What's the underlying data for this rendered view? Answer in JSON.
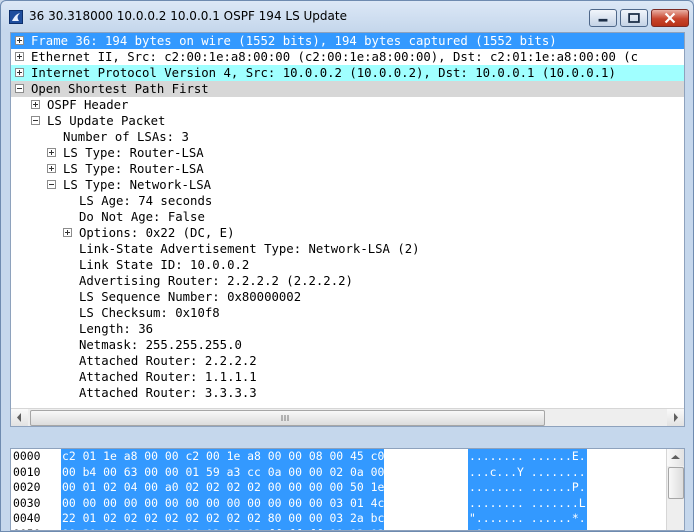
{
  "window": {
    "title": "36 30.318000 10.0.0.2 10.0.0.1 OSPF 194 LS Update"
  },
  "colors": {
    "selection": "#3399ff",
    "ip_row": "#a0ffff",
    "ospf_row": "#d7d7d7"
  },
  "tree": [
    {
      "text": "Frame 36: 194 bytes on wire (1552 bits), 194 bytes captured (1552 bits)",
      "state": "collapsed",
      "level": 0,
      "style": "sel"
    },
    {
      "text": "Ethernet II, Src: c2:00:1e:a8:00:00 (c2:00:1e:a8:00:00), Dst: c2:01:1e:a8:00:00 (c",
      "state": "collapsed",
      "level": 0,
      "style": ""
    },
    {
      "text": "Internet Protocol Version 4, Src: 10.0.0.2 (10.0.0.2), Dst: 10.0.0.1 (10.0.0.1)",
      "state": "collapsed",
      "level": 0,
      "style": "cyan"
    },
    {
      "text": "Open Shortest Path First",
      "state": "expanded",
      "level": 0,
      "style": "gray"
    },
    {
      "text": "OSPF Header",
      "state": "collapsed",
      "level": 1,
      "style": ""
    },
    {
      "text": "LS Update Packet",
      "state": "expanded",
      "level": 1,
      "style": ""
    },
    {
      "text": "Number of LSAs: 3",
      "state": "leaf",
      "level": 2,
      "style": ""
    },
    {
      "text": "LS Type: Router-LSA",
      "state": "collapsed",
      "level": 2,
      "style": ""
    },
    {
      "text": "LS Type: Router-LSA",
      "state": "collapsed",
      "level": 2,
      "style": ""
    },
    {
      "text": "LS Type: Network-LSA",
      "state": "expanded",
      "level": 2,
      "style": ""
    },
    {
      "text": "LS Age: 74 seconds",
      "state": "leaf",
      "level": 3,
      "style": ""
    },
    {
      "text": "Do Not Age: False",
      "state": "leaf",
      "level": 3,
      "style": ""
    },
    {
      "text": "Options: 0x22 (DC, E)",
      "state": "collapsed",
      "level": 3,
      "style": ""
    },
    {
      "text": "Link-State Advertisement Type: Network-LSA (2)",
      "state": "leaf",
      "level": 3,
      "style": ""
    },
    {
      "text": "Link State ID: 10.0.0.2",
      "state": "leaf",
      "level": 3,
      "style": ""
    },
    {
      "text": "Advertising Router: 2.2.2.2 (2.2.2.2)",
      "state": "leaf",
      "level": 3,
      "style": ""
    },
    {
      "text": "LS Sequence Number: 0x80000002",
      "state": "leaf",
      "level": 3,
      "style": ""
    },
    {
      "text": "LS Checksum: 0x10f8",
      "state": "leaf",
      "level": 3,
      "style": ""
    },
    {
      "text": "Length: 36",
      "state": "leaf",
      "level": 3,
      "style": ""
    },
    {
      "text": "Netmask: 255.255.255.0",
      "state": "leaf",
      "level": 3,
      "style": ""
    },
    {
      "text": "Attached Router: 2.2.2.2",
      "state": "leaf",
      "level": 3,
      "style": ""
    },
    {
      "text": "Attached Router: 1.1.1.1",
      "state": "leaf",
      "level": 3,
      "style": ""
    },
    {
      "text": "Attached Router: 3.3.3.3",
      "state": "leaf",
      "level": 3,
      "style": ""
    }
  ],
  "hex_dump": [
    {
      "offset": "0000",
      "hex": "c2 01 1e a8 00 00 c2 00  1e a8 00 00 08 00 45 c0",
      "ascii": "........ ......E."
    },
    {
      "offset": "0010",
      "hex": "00 b4 00 63 00 00 01 59  a3 cc 0a 00 00 02 0a 00",
      "ascii": "...c...Y ........"
    },
    {
      "offset": "0020",
      "hex": "00 01 02 04 00 a0 02 02  02 02 00 00 00 00 50 1e",
      "ascii": "........ ......P."
    },
    {
      "offset": "0030",
      "hex": "00 00 00 00 00 00 00 00  00 00 00 00 00 03 01 4c",
      "ascii": "........ .......L"
    },
    {
      "offset": "0040",
      "hex": "22 01 02 02 02 02 02 02  02 02 80 00 00 03 2a bc",
      "ascii": "\"....... ......*."
    },
    {
      "offset": "0050",
      "hex": "00 30 00 00 00 02 02 02  02 02 ff ff ff 00 02 02",
      "ascii": ".0...... ........"
    }
  ]
}
